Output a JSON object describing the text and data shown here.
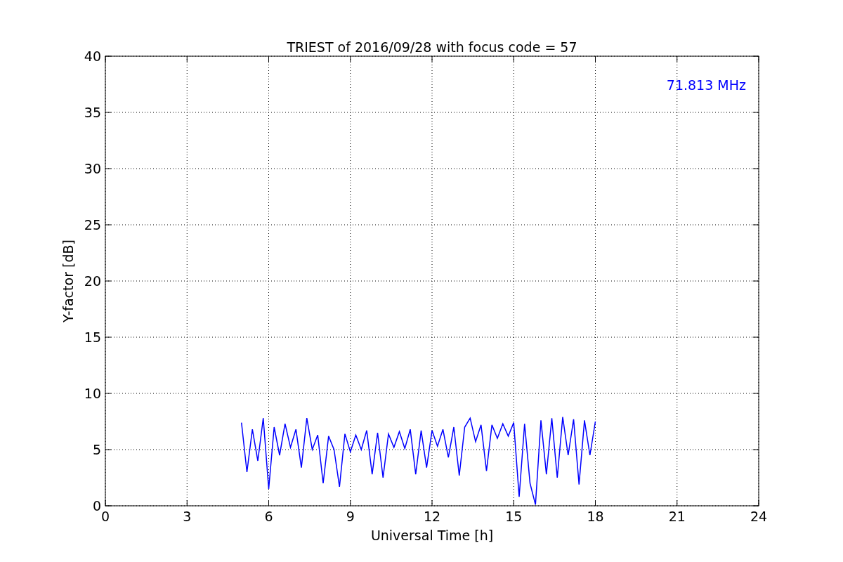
{
  "figure": {
    "chart_data": {
      "type": "line",
      "title": "TRIEST of 2016/09/28 with focus code = 57",
      "xlabel": "Universal Time [h]",
      "ylabel": "Y-factor [dB]",
      "xlim": [
        0,
        24
      ],
      "ylim": [
        0,
        40
      ],
      "xticks": [
        0,
        3,
        6,
        9,
        12,
        15,
        18,
        21,
        24
      ],
      "yticks": [
        0,
        5,
        10,
        15,
        20,
        25,
        30,
        35,
        40
      ],
      "x": [
        5.0,
        5.2,
        5.4,
        5.6,
        5.8,
        6.0,
        6.2,
        6.4,
        6.6,
        6.8,
        7.0,
        7.2,
        7.4,
        7.6,
        7.8,
        8.0,
        8.2,
        8.4,
        8.6,
        8.8,
        9.0,
        9.2,
        9.4,
        9.6,
        9.8,
        10.0,
        10.2,
        10.4,
        10.6,
        10.8,
        11.0,
        11.2,
        11.4,
        11.6,
        11.8,
        12.0,
        12.2,
        12.4,
        12.6,
        12.8,
        13.0,
        13.2,
        13.4,
        13.6,
        13.8,
        14.0,
        14.2,
        14.4,
        14.6,
        14.8,
        15.0,
        15.2,
        15.4,
        15.6,
        15.8,
        16.0,
        16.2,
        16.4,
        16.6,
        16.8,
        17.0,
        17.2,
        17.4,
        17.6,
        17.8,
        18.0
      ],
      "grid": true,
      "series": [
        {
          "color": "#0000ff",
          "values": [
            7.4,
            3.0,
            6.8,
            4.0,
            7.8,
            1.5,
            7.0,
            4.5,
            7.3,
            5.2,
            6.8,
            3.4,
            7.8,
            5.0,
            6.3,
            2.0,
            6.2,
            5.0,
            1.7,
            6.4,
            4.8,
            6.3,
            5.0,
            6.7,
            2.8,
            6.5,
            2.5,
            6.4,
            5.2,
            6.6,
            5.1,
            6.8,
            2.8,
            6.7,
            3.4,
            6.7,
            5.3,
            6.8,
            4.3,
            7.0,
            2.7,
            7.0,
            7.8,
            5.7,
            7.2,
            3.1,
            7.2,
            6.0,
            7.3,
            6.2,
            7.4,
            0.8,
            7.3,
            2.0,
            0.1,
            7.6,
            2.8,
            7.8,
            2.5,
            7.9,
            4.5,
            7.7,
            1.9,
            7.6,
            4.5,
            7.5
          ]
        }
      ],
      "annotations": [
        "71.813 MHz"
      ]
    }
  }
}
